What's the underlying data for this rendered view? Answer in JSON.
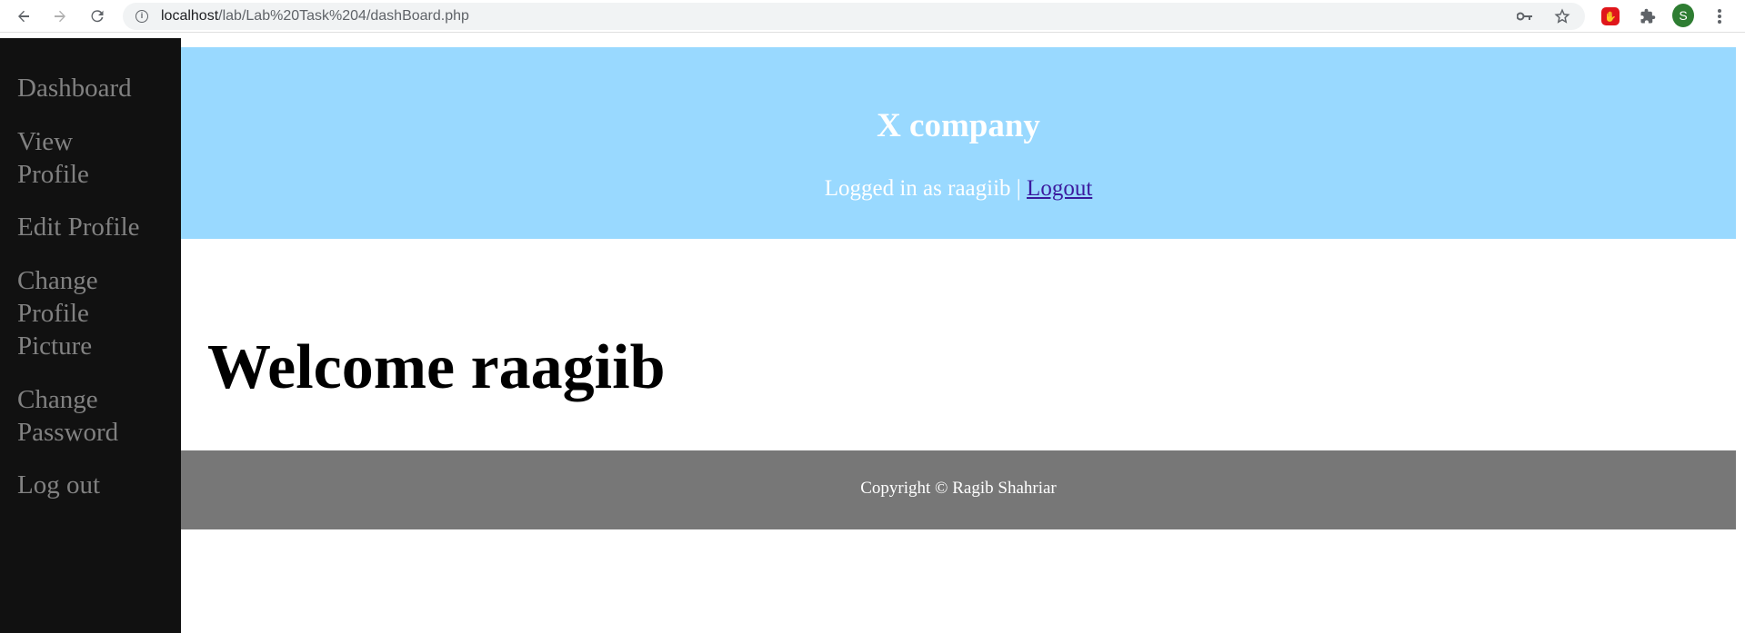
{
  "browser": {
    "url_host": "localhost",
    "url_path": "/lab/Lab%20Task%204/dashBoard.php",
    "icons": {
      "back": "arrow-left-icon",
      "forward": "arrow-right-icon",
      "reload": "reload-icon",
      "info": "info-icon",
      "key": "key-icon",
      "star": "star-icon",
      "adblock": "adblock-icon",
      "extensions": "puzzle-icon",
      "menu": "kebab-menu-icon"
    },
    "profile_initial": "S"
  },
  "sidebar": {
    "items": [
      {
        "label": "Dashboard"
      },
      {
        "label": "View Profile"
      },
      {
        "label": "Edit Profile"
      },
      {
        "label": "Change Profile Picture"
      },
      {
        "label": "Change Password"
      },
      {
        "label": "Log out"
      }
    ]
  },
  "header": {
    "title": "X company",
    "logged_in_text": "Logged in as raagiib |",
    "logout_label": "Logout"
  },
  "main": {
    "welcome": "Welcome raagiib"
  },
  "footer": {
    "copyright": "Copyright © Ragib Shahriar"
  },
  "colors": {
    "sidebar_bg": "#111111",
    "sidebar_text": "#818181",
    "header_bg": "#99d9ff",
    "footer_bg": "#777777",
    "link": "#3b1a9e"
  }
}
